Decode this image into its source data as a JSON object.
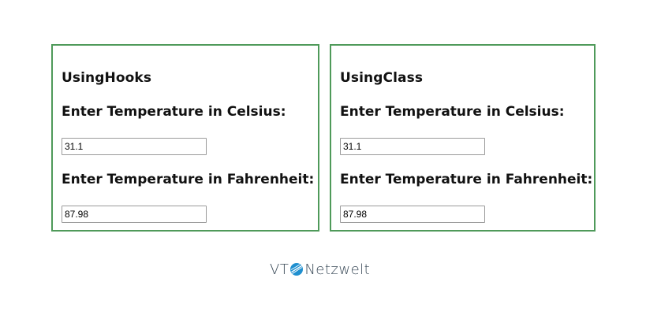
{
  "panels": [
    {
      "title": "UsingHooks",
      "celsius_label": "Enter Temperature in Celsius:",
      "celsius_value": "31.1",
      "fahrenheit_label": "Enter Temperature in Fahrenheit:",
      "fahrenheit_value": "87.98"
    },
    {
      "title": "UsingClass",
      "celsius_label": "Enter Temperature in Celsius:",
      "celsius_value": "31.1",
      "fahrenheit_label": "Enter Temperature in Fahrenheit:",
      "fahrenheit_value": "87.98"
    }
  ],
  "logo": {
    "prefix": "VT",
    "suffix": "Netzwelt",
    "icon": "globe-icon"
  },
  "colors": {
    "panel_border": "#4f9a5a",
    "logo_text": "#3a4a58",
    "logo_globe": "#1f8fcf"
  }
}
